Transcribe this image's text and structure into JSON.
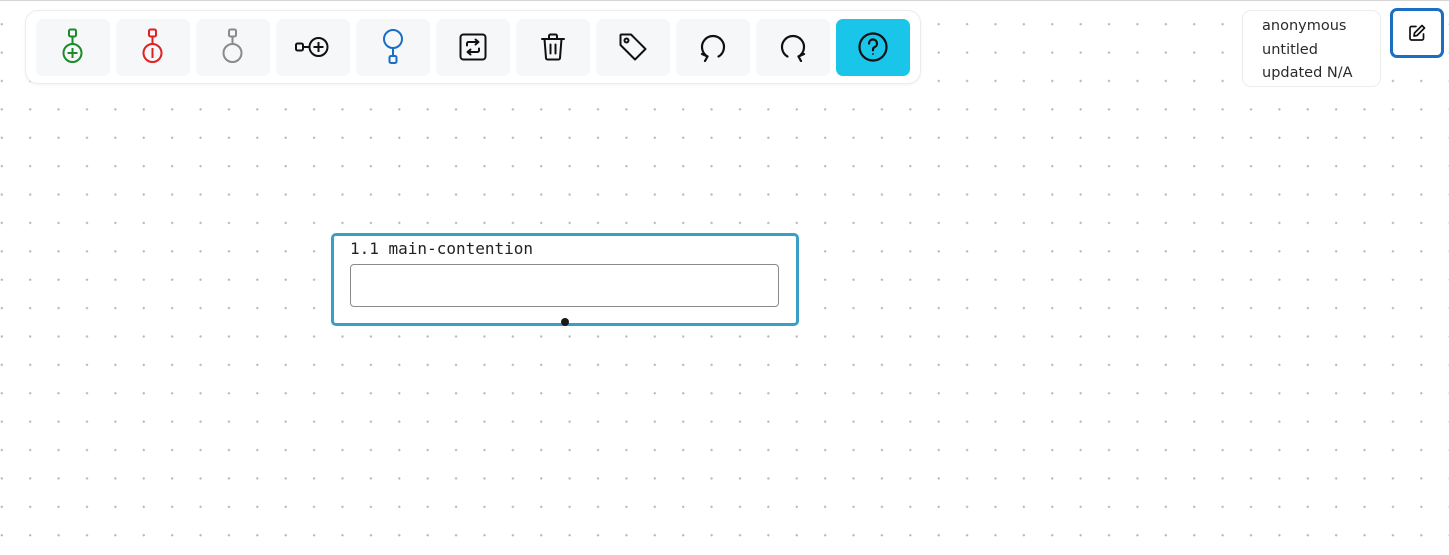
{
  "toolbar": {
    "buttons": [
      {
        "icon": "add-supporting-icon",
        "color": "#1a8a2a"
      },
      {
        "icon": "add-objection-icon",
        "color": "#e02020"
      },
      {
        "icon": "add-neutral-icon",
        "color": "#8a8a8a"
      },
      {
        "icon": "add-linked-claim-icon",
        "color": "#111111"
      },
      {
        "icon": "add-conclusion-icon",
        "color": "#1a6ec4"
      },
      {
        "icon": "swap-icon",
        "color": "#111111"
      },
      {
        "icon": "trash-icon",
        "color": "#111111"
      },
      {
        "icon": "tag-icon",
        "color": "#111111"
      },
      {
        "icon": "undo-icon",
        "color": "#111111"
      },
      {
        "icon": "redo-icon",
        "color": "#111111"
      },
      {
        "icon": "help-icon",
        "color": "#111111",
        "background": "#19c6ea"
      }
    ]
  },
  "meta": {
    "author": "anonymous",
    "title": "untitled",
    "updated": "updated N/A"
  },
  "edit_button": {
    "icon": "edit-icon",
    "border_color": "#1a6ec4"
  },
  "node": {
    "title": "1.1 main-contention",
    "input_value": "",
    "input_placeholder": "",
    "border_color": "#3b9ec5"
  }
}
